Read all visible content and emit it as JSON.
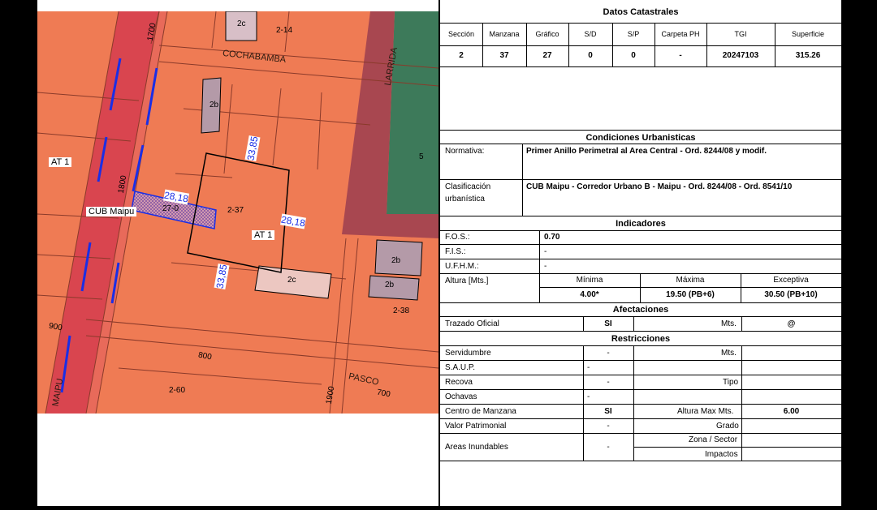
{
  "map": {
    "streets": {
      "cochabamba": "COCHABAMBA",
      "larrida": "LARRIDA",
      "maipu": "MAIPU",
      "pasco": "PASCO"
    },
    "numbers": {
      "n1700": "1700",
      "n1800": "1800",
      "n900a": "900",
      "n900b": "1900",
      "n800": "800",
      "n700": "700"
    },
    "block_labels": {
      "b2_14": "2-14",
      "b2_37": "2-37",
      "b2_38": "2-38",
      "b2_60": "2-60",
      "b5": "5",
      "b27_0": "27-0",
      "b2c_top": "2c",
      "b2c_bottom": "2c",
      "b2b_left": "2b",
      "b2b_right1": "2b",
      "b2b_right2": "2b"
    },
    "zones": {
      "at1_left": "AT 1",
      "at1_center": "AT 1",
      "cub_maipu": "CUB Maipu"
    },
    "dimensions": {
      "d_top": "33,85",
      "d_bottom": "33,85",
      "d_left": "28,18",
      "d_right": "28,18"
    },
    "colors": {
      "zone_orange": "#ef7b54",
      "corridor_red": "#d9454f",
      "green_zone": "#3d7a5a",
      "purple_building": "#b49aa8"
    }
  },
  "catastro": {
    "title": "Datos Catastrales",
    "headers": [
      "Sección",
      "Manzana",
      "Gráfico",
      "S/D",
      "S/P",
      "Carpeta PH",
      "TGI",
      "Superficie"
    ],
    "values": [
      "2",
      "37",
      "27",
      "0",
      "0",
      "-",
      "20247103",
      "315.26"
    ]
  },
  "urbanisticas": {
    "title": "Condiciones Urbanisticas",
    "normativa_label": "Normativa:",
    "normativa_value": "Primer Anillo Perimetral al Area Central - Ord. 8244/08 y modif.",
    "clasificacion_label_1": "Clasificación",
    "clasificacion_label_2": "urbanística",
    "clasificacion_value": "CUB Maipu - Corredor Urbano B - Maipu - Ord. 8244/08 - Ord. 8541/10"
  },
  "indicadores": {
    "title": "Indicadores",
    "fos_label": "F.O.S.:",
    "fos_value": "0.70",
    "fis_label": "F.I.S.:",
    "fis_value": "-",
    "ufhm_label": "U.F.H.M.:",
    "ufhm_value": "-",
    "altura_label": "Altura [Mts.]",
    "minima_label": "Mínima",
    "maxima_label": "Máxima",
    "excepcional_label": "Exceptiva",
    "minima_value": "4.00*",
    "maxima_value": "19.50 (PB+6)",
    "excepcional_value": "30.50 (PB+10)"
  },
  "afectaciones": {
    "title": "Afectaciones",
    "trazado_label": "Trazado Oficial",
    "trazado_value": "SI",
    "mts_label": "Mts.",
    "mts_value": "@"
  },
  "restricciones": {
    "title": "Restricciones",
    "rows": {
      "servidumbre": "Servidumbre",
      "servidumbre_value": "-",
      "servidumbre_mts": "Mts.",
      "saup": "S.A.U.P.",
      "saup_value": "-",
      "recova": "Recova",
      "recova_value": "-",
      "recova_tipo": "Tipo",
      "ochavas": "Ochavas",
      "ochavas_value": "-",
      "centro": "Centro de Manzana",
      "centro_value": "SI",
      "altura_max": "Altura Max Mts.",
      "altura_max_value": "6.00",
      "valor": "Valor Patrimonial",
      "valor_value": "-",
      "grado": "Grado",
      "areas": "Areas Inundables",
      "areas_value": "-",
      "zona": "Zona / Sector",
      "impactos": "Impactos"
    }
  }
}
